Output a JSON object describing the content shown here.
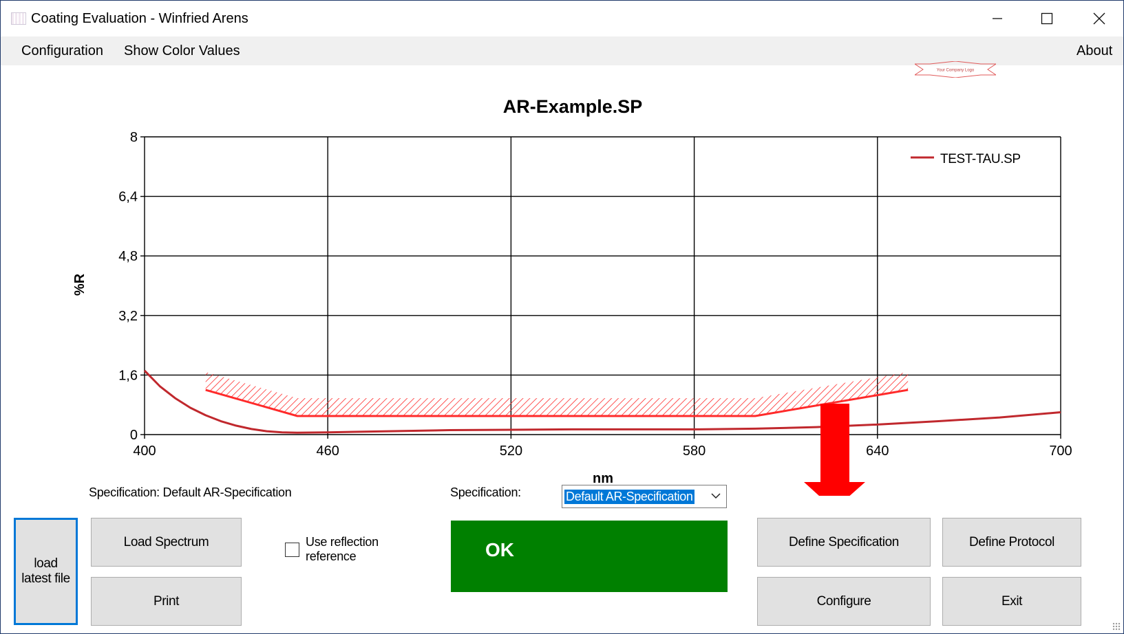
{
  "window": {
    "title": "Coating Evaluation - Winfried Arens",
    "minimize_icon": "minimize-icon",
    "maximize_icon": "maximize-icon",
    "close_icon": "close-icon"
  },
  "menu": {
    "items": [
      "Configuration",
      "Show Color Values"
    ],
    "about": "About"
  },
  "logo_text": "Your Company Logo",
  "chart_data": {
    "type": "line",
    "title": "AR-Example.SP",
    "xlabel": "nm",
    "ylabel": "%R",
    "xlim": [
      400,
      700
    ],
    "ylim": [
      0,
      8
    ],
    "x_ticks": [
      "400",
      "460",
      "520",
      "580",
      "640",
      "700"
    ],
    "y_ticks": [
      "0",
      "1,6",
      "3,2",
      "4,8",
      "6,4",
      "8"
    ],
    "grid": true,
    "legend_position": "top-right",
    "series": [
      {
        "name": "TEST-TAU.SP",
        "color": "#c0282d",
        "x": [
          400,
          405,
          410,
          415,
          420,
          425,
          430,
          435,
          440,
          445,
          450,
          460,
          480,
          500,
          520,
          540,
          560,
          580,
          600,
          620,
          640,
          660,
          680,
          700
        ],
        "y": [
          1.72,
          1.3,
          0.98,
          0.72,
          0.52,
          0.36,
          0.24,
          0.15,
          0.09,
          0.06,
          0.05,
          0.06,
          0.09,
          0.12,
          0.13,
          0.14,
          0.14,
          0.14,
          0.16,
          0.2,
          0.27,
          0.36,
          0.46,
          0.6
        ]
      }
    ],
    "specification_limit": {
      "color": "#ff2a2a",
      "x": [
        420,
        450,
        600,
        650
      ],
      "y": [
        1.2,
        0.5,
        0.5,
        1.2
      ]
    }
  },
  "spec_info": "Specification: Default AR-Specification",
  "spec_select": {
    "label": "Specification:",
    "value": "Default AR-Specification"
  },
  "buttons": {
    "load_latest": [
      "load",
      "latest file"
    ],
    "load_spectrum": "Load Spectrum",
    "print": "Print",
    "define_specification": "Define Specification",
    "define_protocol": "Define Protocol",
    "configure": "Configure",
    "exit": "Exit"
  },
  "checkbox": {
    "label": "Use reflection reference",
    "checked": false
  },
  "result": {
    "text": "OK",
    "color": "#008000"
  },
  "annotation": {
    "arrow_color": "#ff0000",
    "points_to": "Define Specification"
  }
}
